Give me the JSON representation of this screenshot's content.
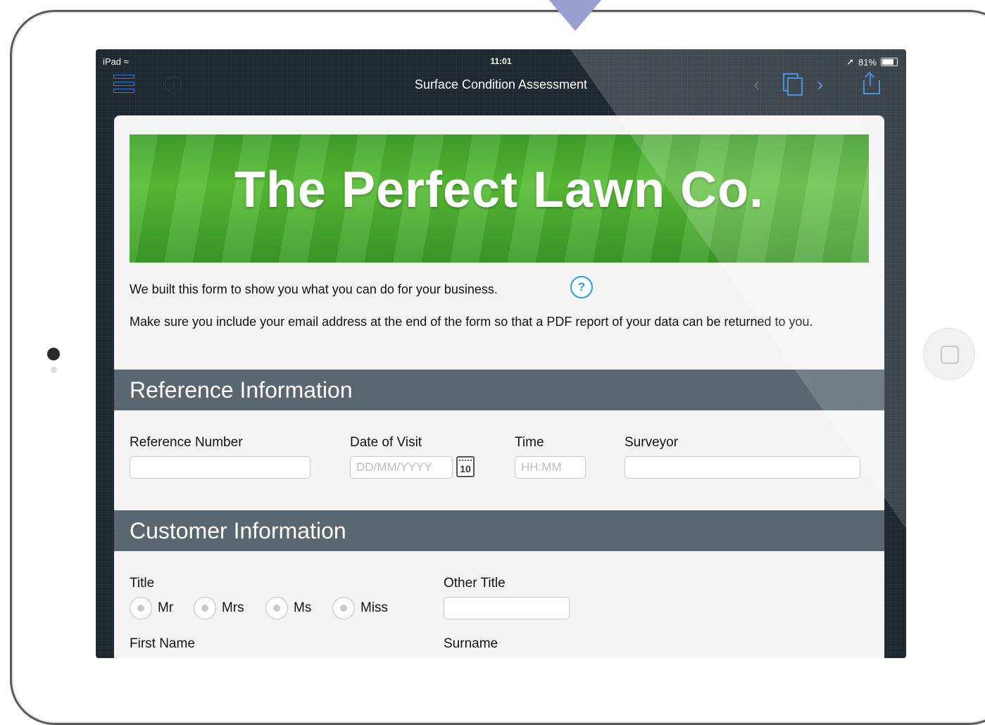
{
  "status": {
    "device": "iPad",
    "time": "11:01",
    "battery": "81%",
    "battery_level": 0.81
  },
  "nav": {
    "title": "Surface Condition Assessment"
  },
  "banner": {
    "text": "The Perfect Lawn Co."
  },
  "intro": {
    "line1": "We built this form to show you what you can do for your business.",
    "line2": "Make sure you include your email address at the end of the form so that a PDF report of your data can be returned to you.",
    "help_icon": "?"
  },
  "reference": {
    "header": "Reference Information",
    "reference_number_label": "Reference Number",
    "date_label": "Date of Visit",
    "date_placeholder": "DD/MM/YYYY",
    "calendar_day": "10",
    "time_label": "Time",
    "time_placeholder": "HH:MM",
    "surveyor_label": "Surveyor"
  },
  "customer": {
    "header": "Customer Information",
    "title_label": "Title",
    "title_options": [
      "Mr",
      "Mrs",
      "Ms",
      "Miss"
    ],
    "other_title_label": "Other Title",
    "first_name_label": "First Name",
    "surname_label": "Surname"
  },
  "colors": {
    "accent": "#2f7fdc",
    "section_header": "#5a6670",
    "banner_green": "#4caf32"
  }
}
